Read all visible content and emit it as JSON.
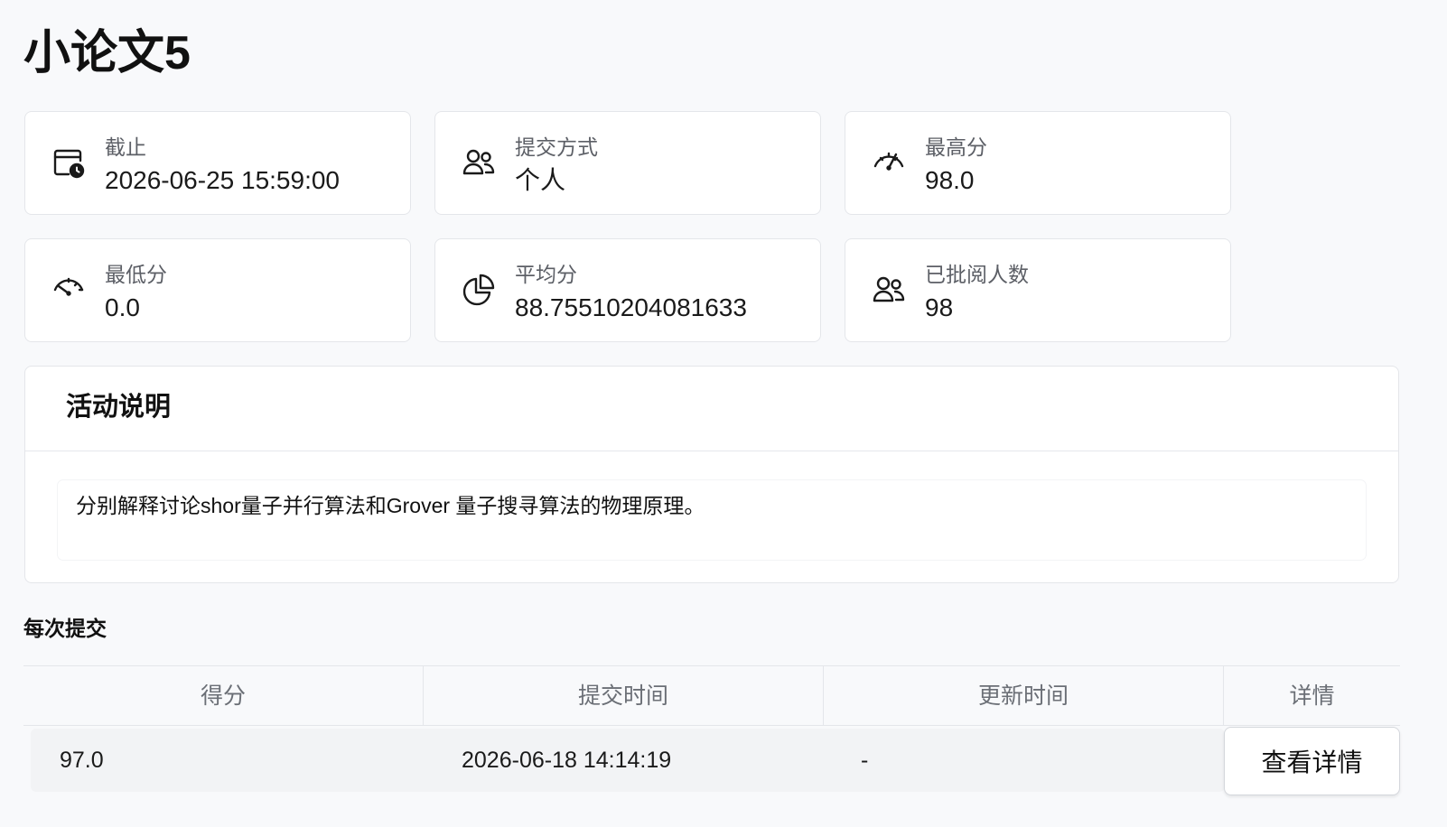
{
  "page": {
    "title": "小论文5"
  },
  "stats": [
    {
      "icon": "calendar-clock-icon",
      "label": "截止",
      "value": "2026-06-25 15:59:00"
    },
    {
      "icon": "users-icon",
      "label": "提交方式",
      "value": "个人"
    },
    {
      "icon": "gauge-high-icon",
      "label": "最高分",
      "value": "98.0"
    },
    {
      "icon": "gauge-low-icon",
      "label": "最低分",
      "value": "0.0"
    },
    {
      "icon": "pie-chart-icon",
      "label": "平均分",
      "value": "88.75510204081633"
    },
    {
      "icon": "users-icon",
      "label": "已批阅人数",
      "value": "98"
    }
  ],
  "description": {
    "title": "活动说明",
    "body": "分别解释讨论shor量子并行算法和Grover 量子搜寻算法的物理原理。"
  },
  "submissions": {
    "title": "每次提交",
    "columns": [
      "得分",
      "提交时间",
      "更新时间",
      "详情"
    ],
    "rows": [
      {
        "score": "97.0",
        "submitted_at": "2026-06-18 14:14:19",
        "updated_at": "-",
        "detail_label": "查看详情"
      }
    ]
  }
}
